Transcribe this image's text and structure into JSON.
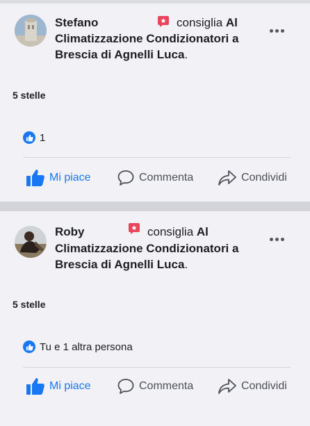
{
  "posts": [
    {
      "author": "Stefano",
      "verb": "consiglia",
      "prefix": "Al",
      "line2": "Climatizzazione Condizionatori a",
      "line3_bold": "Brescia di Agnelli Luca",
      "line3_tail": ".",
      "rating": "5 stelle",
      "reactions_text": "1",
      "actions": {
        "like": "Mi piace",
        "comment": "Commenta",
        "share": "Condividi"
      }
    },
    {
      "author": "Roby",
      "verb": "consiglia",
      "prefix": "Al",
      "line2": "Climatizzazione Condizionatori a",
      "line3_bold": "Brescia di Agnelli Luca",
      "line3_tail": ".",
      "rating": "5 stelle",
      "reactions_text": "Tu e 1 altra persona",
      "actions": {
        "like": "Mi piace",
        "comment": "Commenta",
        "share": "Condividi"
      }
    }
  ],
  "colors": {
    "accent": "#1877f2",
    "recommend": "#e8445a",
    "text": "#1c1e21",
    "muted": "#4b4f56"
  }
}
